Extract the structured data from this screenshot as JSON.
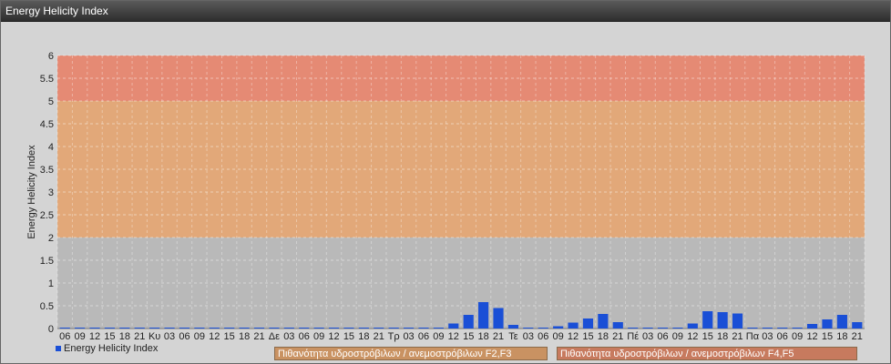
{
  "window": {
    "title": "Energy Helicity Index"
  },
  "chart_data": {
    "type": "bar",
    "title": "",
    "ylabel": "Energy Helicity Index",
    "xlabel": "",
    "ylim": [
      0,
      6
    ],
    "yticks": [
      "0",
      "0.5",
      "1",
      "1.5",
      "2",
      "2.5",
      "3",
      "3.5",
      "4",
      "4.5",
      "5",
      "5.5",
      "6"
    ],
    "categories": [
      "06",
      "09",
      "12",
      "15",
      "18",
      "21",
      "Κυ",
      "03",
      "06",
      "09",
      "12",
      "15",
      "18",
      "21",
      "Δε",
      "03",
      "06",
      "09",
      "12",
      "15",
      "18",
      "21",
      "Τρ",
      "03",
      "06",
      "09",
      "12",
      "15",
      "18",
      "21",
      "Τε",
      "03",
      "06",
      "09",
      "12",
      "15",
      "18",
      "21",
      "Πέ",
      "03",
      "06",
      "09",
      "12",
      "15",
      "18",
      "21",
      "Πα",
      "03",
      "06",
      "09",
      "12",
      "15",
      "18",
      "21"
    ],
    "series": [
      {
        "name": "Energy Helicity Index",
        "color": "#1a4fd6",
        "values": [
          0.02,
          0.02,
          0.02,
          0.02,
          0.02,
          0.02,
          0.02,
          0.02,
          0.02,
          0.02,
          0.02,
          0.02,
          0.02,
          0.02,
          0.02,
          0.02,
          0.02,
          0.02,
          0.02,
          0.02,
          0.02,
          0.02,
          0.02,
          0.02,
          0.02,
          0.02,
          0.11,
          0.3,
          0.58,
          0.45,
          0.08,
          0.02,
          0.02,
          0.05,
          0.13,
          0.22,
          0.32,
          0.14,
          0.02,
          0.02,
          0.02,
          0.02,
          0.11,
          0.38,
          0.36,
          0.33,
          0.02,
          0.02,
          0.02,
          0.02,
          0.1,
          0.2,
          0.3,
          0.14
        ]
      }
    ],
    "bands": [
      {
        "from": 5,
        "to": 6,
        "color": "#e58a74"
      },
      {
        "from": 2,
        "to": 5,
        "color": "#e2a879"
      },
      {
        "from": 0,
        "to": 2,
        "color": "#b9b9b9"
      }
    ],
    "legend": {
      "series_label": "Energy Helicity Index",
      "band1_label": "Πιθανότητα υδροστρόβιλων / ανεμοστρόβιλων F2,F3",
      "band2_label": "Πιθανότητα υδροστρόβιλων / ανεμοστρόβιλων F4,F5"
    },
    "grid": true
  }
}
